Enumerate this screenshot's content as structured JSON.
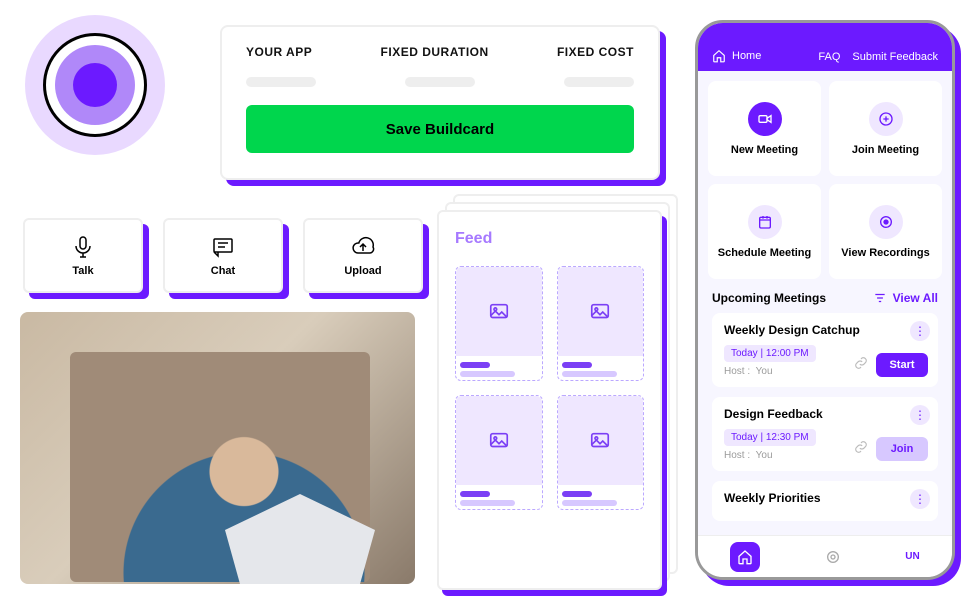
{
  "buildcard": {
    "col1": "YOUR APP",
    "col2": "FIXED DURATION",
    "col3": "FIXED COST",
    "save_label": "Save Buildcard"
  },
  "actions": {
    "talk": "Talk",
    "chat": "Chat",
    "upload": "Upload"
  },
  "feed": {
    "title": "Feed"
  },
  "phone": {
    "home": "Home",
    "faq": "FAQ",
    "feedback": "Submit Feedback",
    "tiles": {
      "new_meeting": "New Meeting",
      "join_meeting": "Join Meeting",
      "schedule_meeting": "Schedule Meeting",
      "view_recordings": "View Recordings"
    },
    "upcoming": "Upcoming Meetings",
    "view_all": "View All",
    "meetings": [
      {
        "title": "Weekly Design Catchup",
        "time": "Today | 12:00 PM",
        "host_label": "Host :",
        "host": "You",
        "action": "Start",
        "action_kind": "start"
      },
      {
        "title": "Design Feedback",
        "time": "Today | 12:30 PM",
        "host_label": "Host :",
        "host": "You",
        "action": "Join",
        "action_kind": "join"
      },
      {
        "title": "Weekly Priorities",
        "time": "",
        "host_label": "",
        "host": "",
        "action": "",
        "action_kind": ""
      }
    ],
    "nav_un": "UN"
  }
}
